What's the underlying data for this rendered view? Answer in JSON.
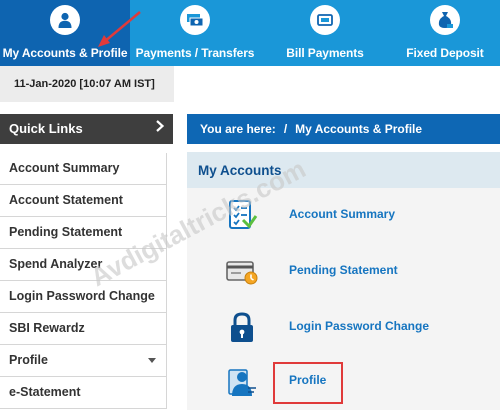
{
  "nav": [
    {
      "label": "My Accounts & Profile",
      "icon": "person-icon",
      "active": true
    },
    {
      "label": "Payments / Transfers",
      "icon": "money-transfer-icon"
    },
    {
      "label": "Bill Payments",
      "icon": "bill-card-icon"
    },
    {
      "label": "Fixed Deposit",
      "icon": "money-bag-icon"
    }
  ],
  "session": {
    "datetime": "11-Jan-2020 [10:07 AM IST]"
  },
  "sidebar": {
    "header": "Quick Links",
    "items": [
      {
        "label": "Account Summary"
      },
      {
        "label": "Account Statement"
      },
      {
        "label": "Pending Statement"
      },
      {
        "label": "Spend Analyzer"
      },
      {
        "label": "Login Password Change"
      },
      {
        "label": "SBI Rewardz"
      },
      {
        "label": "Profile",
        "has_dropdown": true
      },
      {
        "label": "e-Statement"
      }
    ]
  },
  "breadcrumb": {
    "prefix": "You are here:",
    "separator": "/",
    "current": "My Accounts & Profile"
  },
  "main": {
    "title": "My Accounts",
    "links": [
      {
        "label": "Account Summary",
        "icon": "account-summary-icon"
      },
      {
        "label": "Pending Statement",
        "icon": "pending-statement-icon"
      },
      {
        "label": "Login Password Change",
        "icon": "lock-icon"
      },
      {
        "label": "Profile",
        "icon": "profile-icon",
        "highlighted": true
      }
    ]
  },
  "watermark": "Avdigitaltricks.com",
  "colors": {
    "nav": "#1a97d8",
    "nav_active": "#0e64b0",
    "breadcrumb": "#0e67b4",
    "link": "#1675c0",
    "highlight": "#e03a3a"
  }
}
